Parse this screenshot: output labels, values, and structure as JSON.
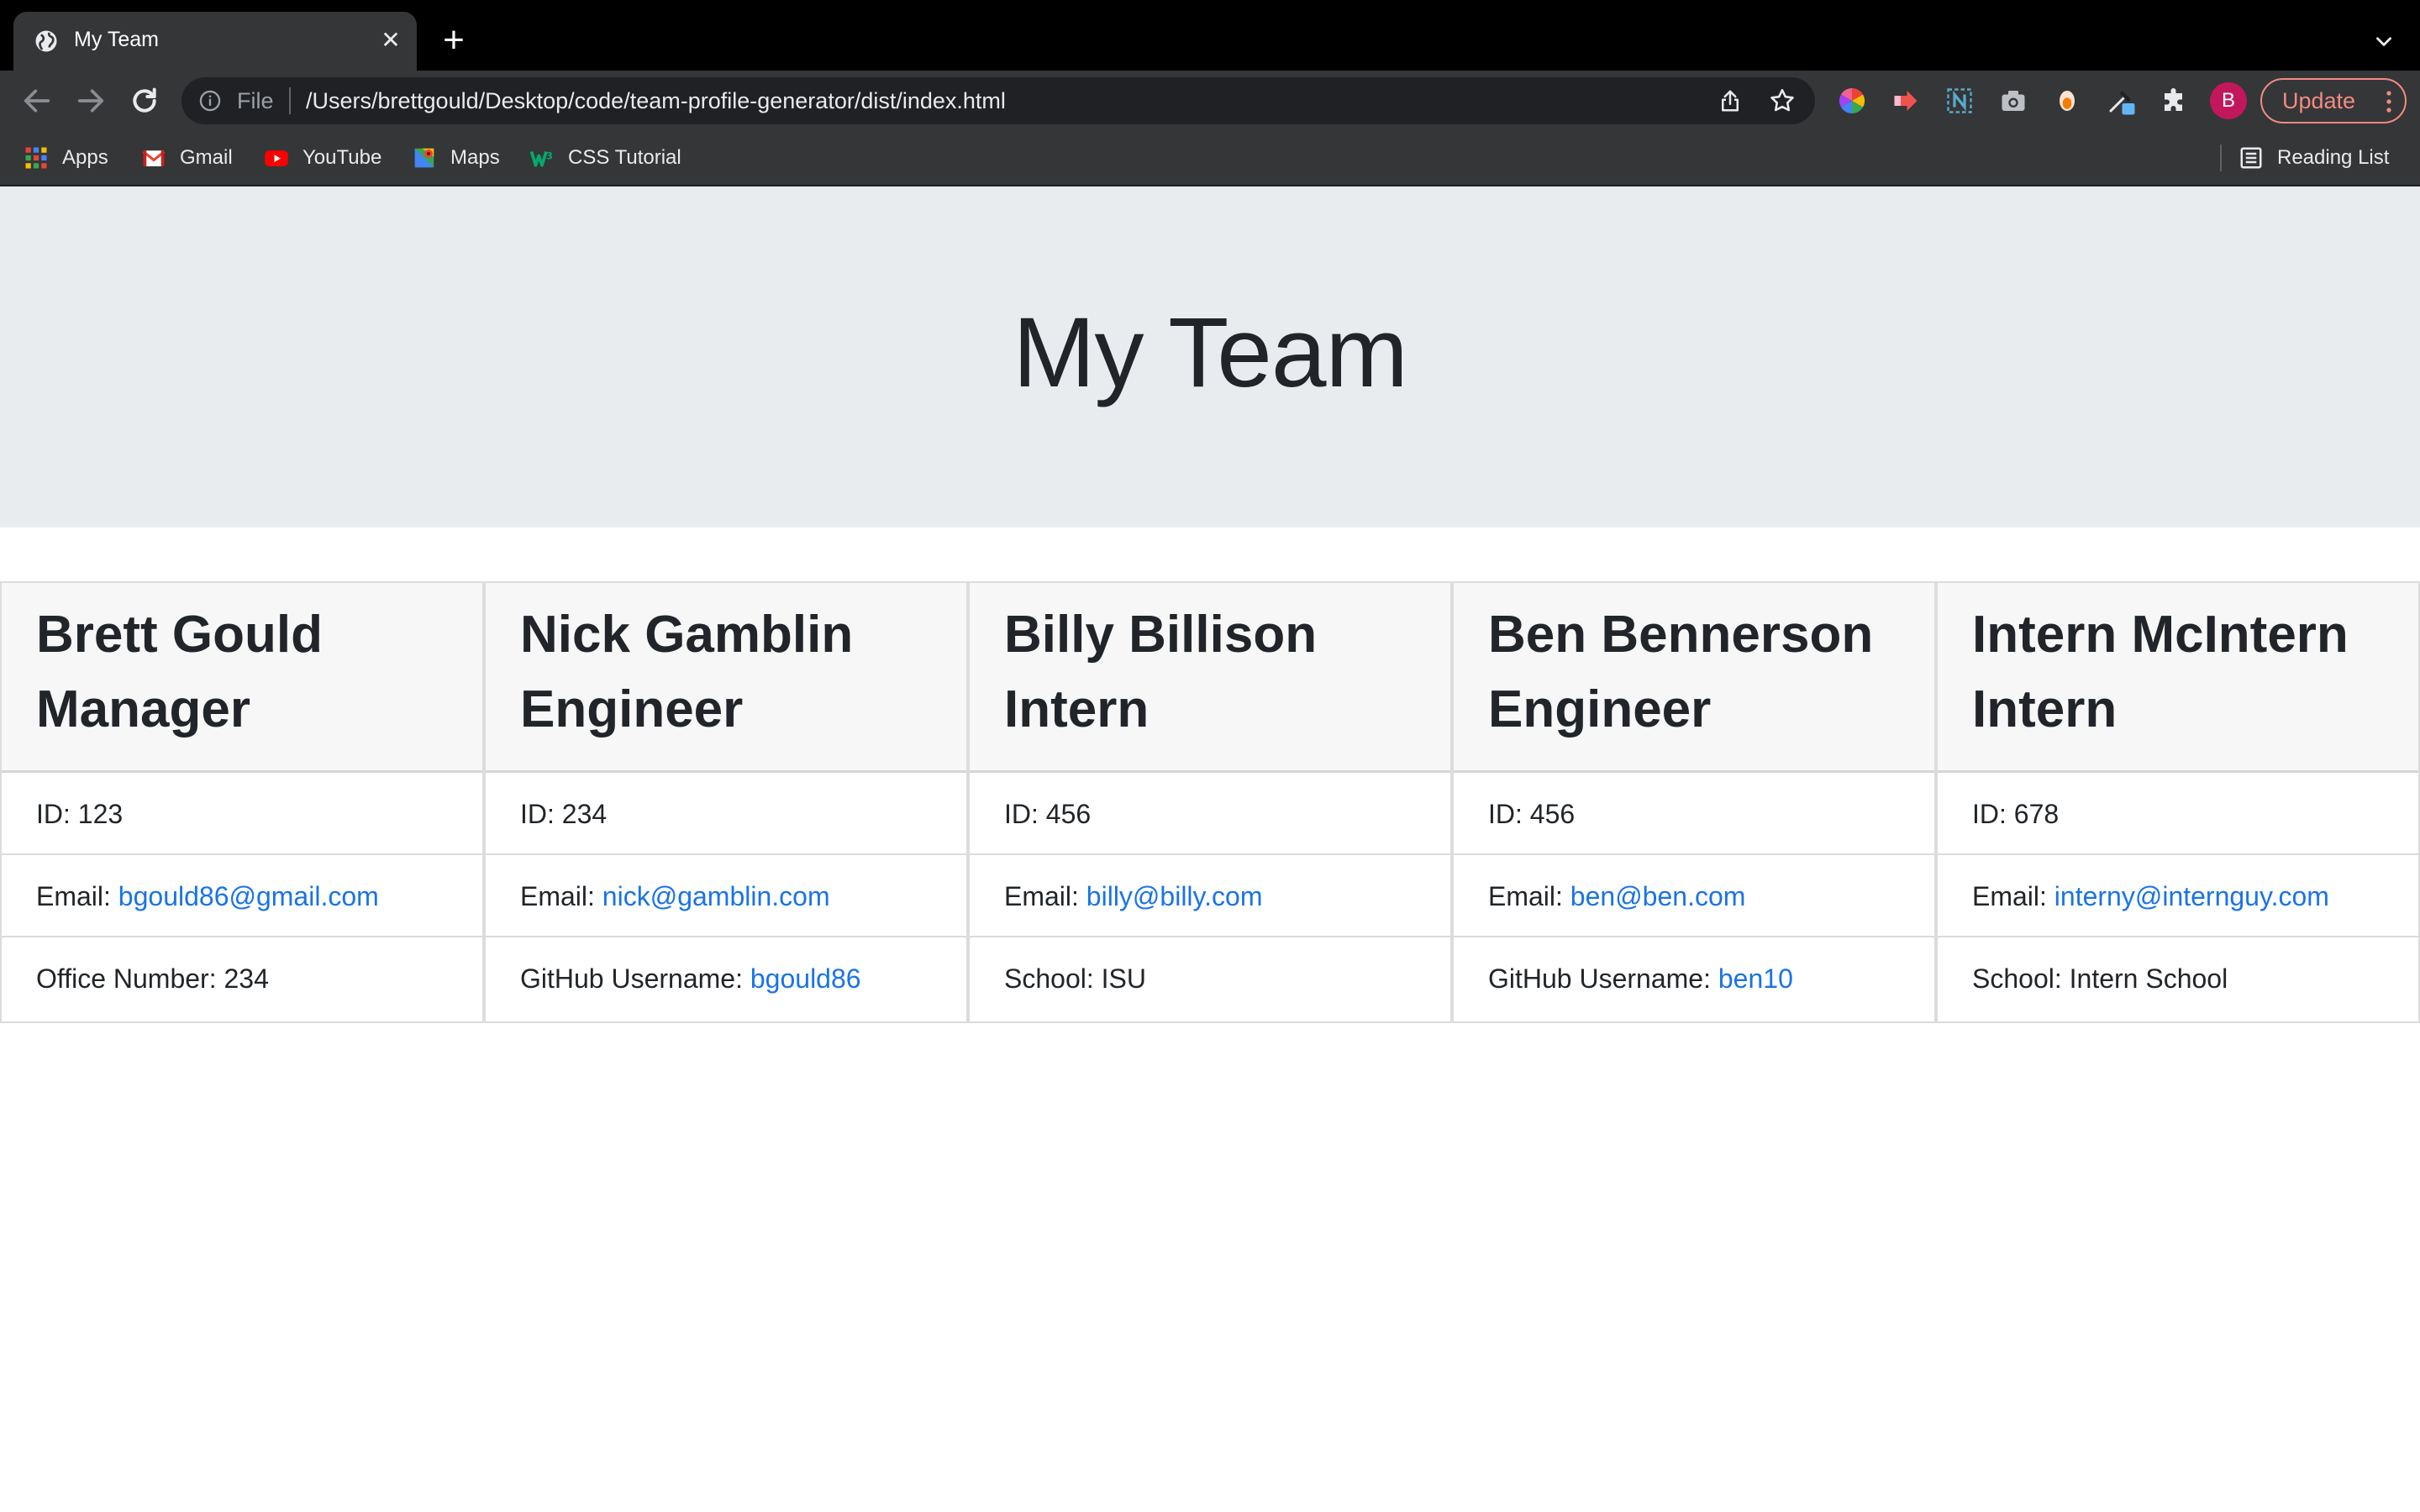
{
  "browser": {
    "tab_title": "My Team",
    "new_tab": "+",
    "tab_close": "✕",
    "omnibox_scheme": "File",
    "url": "/Users/brettgould/Desktop/code/team-profile-generator/dist/index.html",
    "profile_initial": "B",
    "update_label": "Update",
    "bookmarks": [
      {
        "label": "Apps",
        "icon": "apps-grid-icon"
      },
      {
        "label": "Gmail",
        "icon": "gmail-icon"
      },
      {
        "label": "YouTube",
        "icon": "youtube-icon"
      },
      {
        "label": "Maps",
        "icon": "maps-icon"
      },
      {
        "label": "CSS Tutorial",
        "icon": "w3schools-icon"
      }
    ],
    "reading_list": "Reading List",
    "extensions": [
      "color-wheel-extension-icon",
      "red-arrow-extension-icon",
      "notion-extension-icon",
      "camera-extension-icon",
      "bulb-extension-icon",
      "eyedropper-extension-icon",
      "puzzle-extensions-icon"
    ]
  },
  "page": {
    "title": "My Team",
    "cards": [
      {
        "name": "Brett Gould",
        "role": "Manager",
        "id_label": "ID: 123",
        "email_label": "Email: ",
        "email": "bgould86@gmail.com",
        "extra_label": "Office Number: 234",
        "extra_link": ""
      },
      {
        "name": "Nick Gamblin",
        "role": "Engineer",
        "id_label": "ID: 234",
        "email_label": "Email: ",
        "email": "nick@gamblin.com",
        "extra_label": "GitHub Username: ",
        "extra_link": "bgould86"
      },
      {
        "name": "Billy Billison",
        "role": "Intern",
        "id_label": "ID: 456",
        "email_label": "Email: ",
        "email": "billy@billy.com",
        "extra_label": "School: ISU",
        "extra_link": ""
      },
      {
        "name": "Ben Bennerson",
        "role": "Engineer",
        "id_label": "ID: 456",
        "email_label": "Email: ",
        "email": "ben@ben.com",
        "extra_label": "GitHub Username: ",
        "extra_link": "ben10"
      },
      {
        "name": "Intern McIntern",
        "role": "Intern",
        "id_label": "ID: 678",
        "email_label": "Email: ",
        "email": "interny@internguy.com",
        "extra_label": "School: Intern School",
        "extra_link": ""
      }
    ]
  },
  "colors": {
    "jumbotron_bg": "#e9ecef",
    "link": "#1a73e8",
    "chrome_dark": "#353638",
    "update_accent": "#f28b82"
  }
}
